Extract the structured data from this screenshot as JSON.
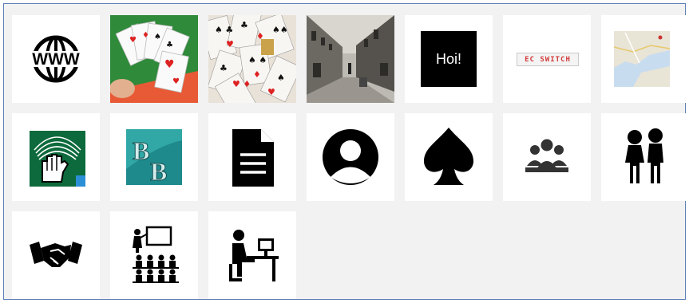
{
  "tiles": [
    {
      "id": "www",
      "label": "WWW"
    },
    {
      "id": "cards-hand",
      "label": ""
    },
    {
      "id": "cards-pile",
      "label": ""
    },
    {
      "id": "street-photo",
      "label": ""
    },
    {
      "id": "hoi",
      "label": "Hoi!"
    },
    {
      "id": "ec-switch",
      "label": "EC SWITCH"
    },
    {
      "id": "map",
      "label": ""
    },
    {
      "id": "bridge-hand-logo",
      "label": ""
    },
    {
      "id": "bb-logo",
      "label": ""
    },
    {
      "id": "document",
      "label": ""
    },
    {
      "id": "user",
      "label": ""
    },
    {
      "id": "spade",
      "label": ""
    },
    {
      "id": "group",
      "label": ""
    },
    {
      "id": "children",
      "label": ""
    },
    {
      "id": "handshake",
      "label": ""
    },
    {
      "id": "classroom",
      "label": ""
    },
    {
      "id": "computer-user",
      "label": ""
    }
  ],
  "colors": {
    "page_bg": "#f2f2f2",
    "tile_bg": "#ffffff",
    "frame": "#5b7fb6"
  }
}
